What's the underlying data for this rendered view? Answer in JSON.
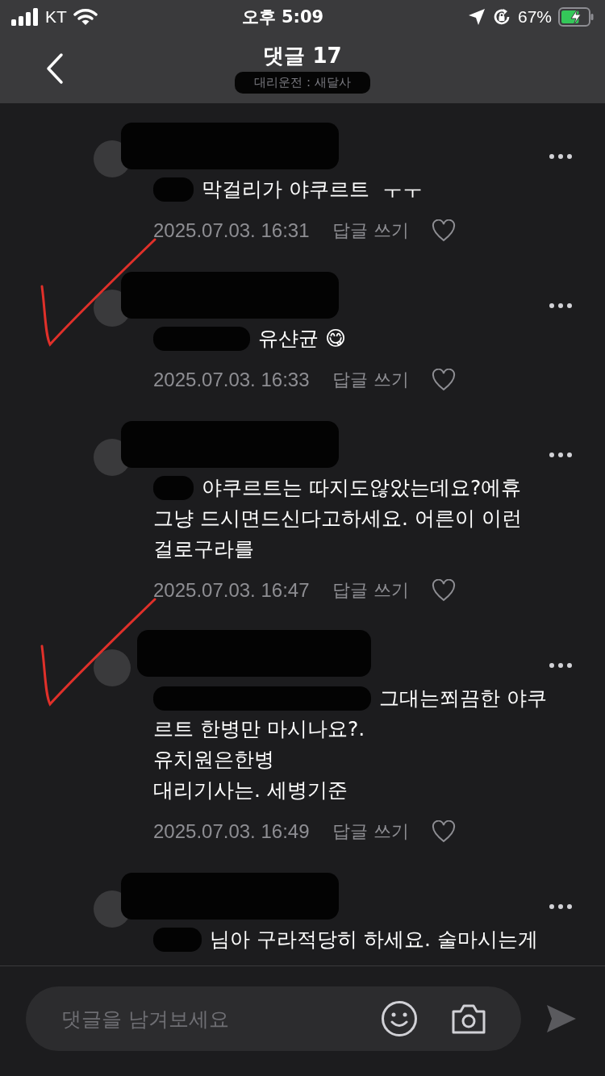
{
  "status_bar": {
    "carrier": "KT",
    "time": "오후 5:09",
    "battery": "67%"
  },
  "header": {
    "title": "댓글 17",
    "subtitle": "대리운전 : 새달사"
  },
  "comments": [
    {
      "lines": [
        "막걸리가 야쿠르트  ㅜㅜ"
      ],
      "date": "2025.07.03. 16:31",
      "reply": "답글 쓰기",
      "liked": false,
      "marked": false
    },
    {
      "lines": [
        "유샨균 😋"
      ],
      "date": "2025.07.03. 16:33",
      "reply": "답글 쓰기",
      "liked": false,
      "marked": true
    },
    {
      "lines": [
        "야쿠르트는 따지도않았는데요?에휴",
        "그냥 드시면드신다고하세요. 어른이 이런",
        "걸로구라를"
      ],
      "date": "2025.07.03. 16:47",
      "reply": "답글 쓰기",
      "liked": false,
      "marked": false
    },
    {
      "lines": [
        "그대는쬐끔한 야쿠",
        "르트 한병만 마시나요?.",
        "유치원은한병",
        "대리기사는. 세병기준"
      ],
      "date": "2025.07.03. 16:49",
      "reply": "답글 쓰기",
      "liked": false,
      "marked": true
    },
    {
      "lines": [
        "님아 구라적당히 하세요. 술마시는게"
      ]
    }
  ],
  "composer": {
    "placeholder": "댓글을 남겨보세요"
  }
}
